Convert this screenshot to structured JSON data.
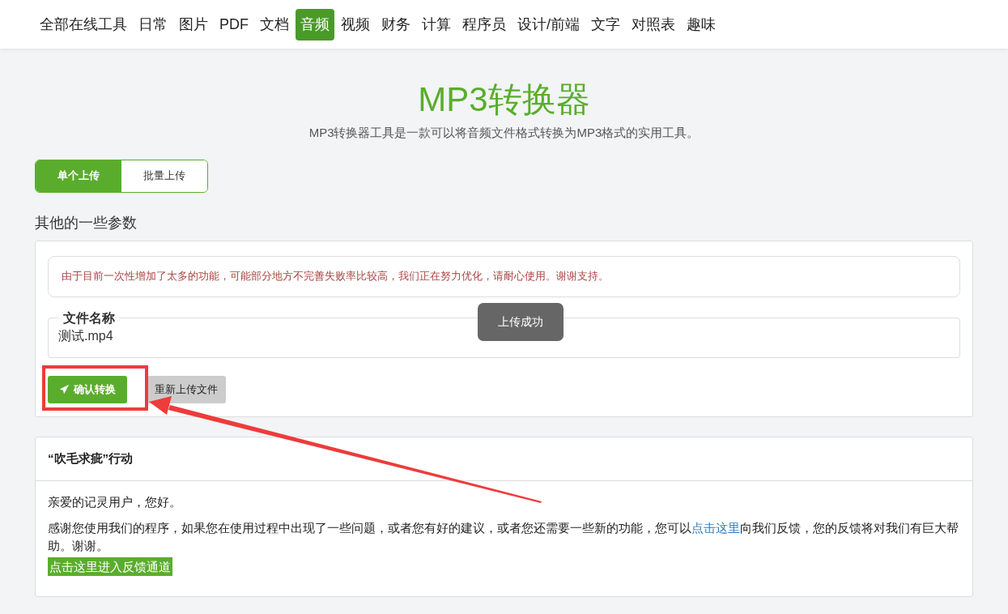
{
  "nav": [
    {
      "label": "全部在线工具",
      "selected": false
    },
    {
      "label": "日常",
      "selected": false
    },
    {
      "label": "图片",
      "selected": false
    },
    {
      "label": "PDF",
      "selected": false
    },
    {
      "label": "文档",
      "selected": false
    },
    {
      "label": "音频",
      "selected": true
    },
    {
      "label": "视频",
      "selected": false
    },
    {
      "label": "财务",
      "selected": false
    },
    {
      "label": "计算",
      "selected": false
    },
    {
      "label": "程序员",
      "selected": false
    },
    {
      "label": "设计/前端",
      "selected": false
    },
    {
      "label": "文字",
      "selected": false
    },
    {
      "label": "对照表",
      "selected": false
    },
    {
      "label": "趣味",
      "selected": false
    }
  ],
  "title": "MP3转换器",
  "subtitle": "MP3转换器工具是一款可以将音频文件格式转换为MP3格式的实用工具。",
  "upload_tabs": [
    {
      "label": "单个上传",
      "selected": true
    },
    {
      "label": "批量上传",
      "selected": false
    }
  ],
  "section_title": "其他的一些参数",
  "notice": "由于目前一次性增加了太多的功能，可能部分地方不完善失败率比较高，我们正在努力优化，请耐心使用。谢谢支持。",
  "file_field": {
    "legend": "文件名称",
    "value": "测试.mp4"
  },
  "toast": "上传成功",
  "buttons": [
    {
      "label": "确认转换",
      "kind": "primary"
    },
    {
      "label": "重新上传文件",
      "kind": "secondary"
    }
  ],
  "feedback": {
    "title": "“吹毛求疵”行动",
    "greeting": "亲爱的记灵用户，您好。",
    "text_before": "感谢您使用我们的程序，如果您在使用过程中出现了一些问题，或者您有好的建议，或者您还需要一些新的功能，您可以",
    "link": "点击这里",
    "text_after": "向我们反馈，您的反馈将对我们有巨大帮助。谢谢。",
    "button": "点击这里进入反馈通道"
  }
}
